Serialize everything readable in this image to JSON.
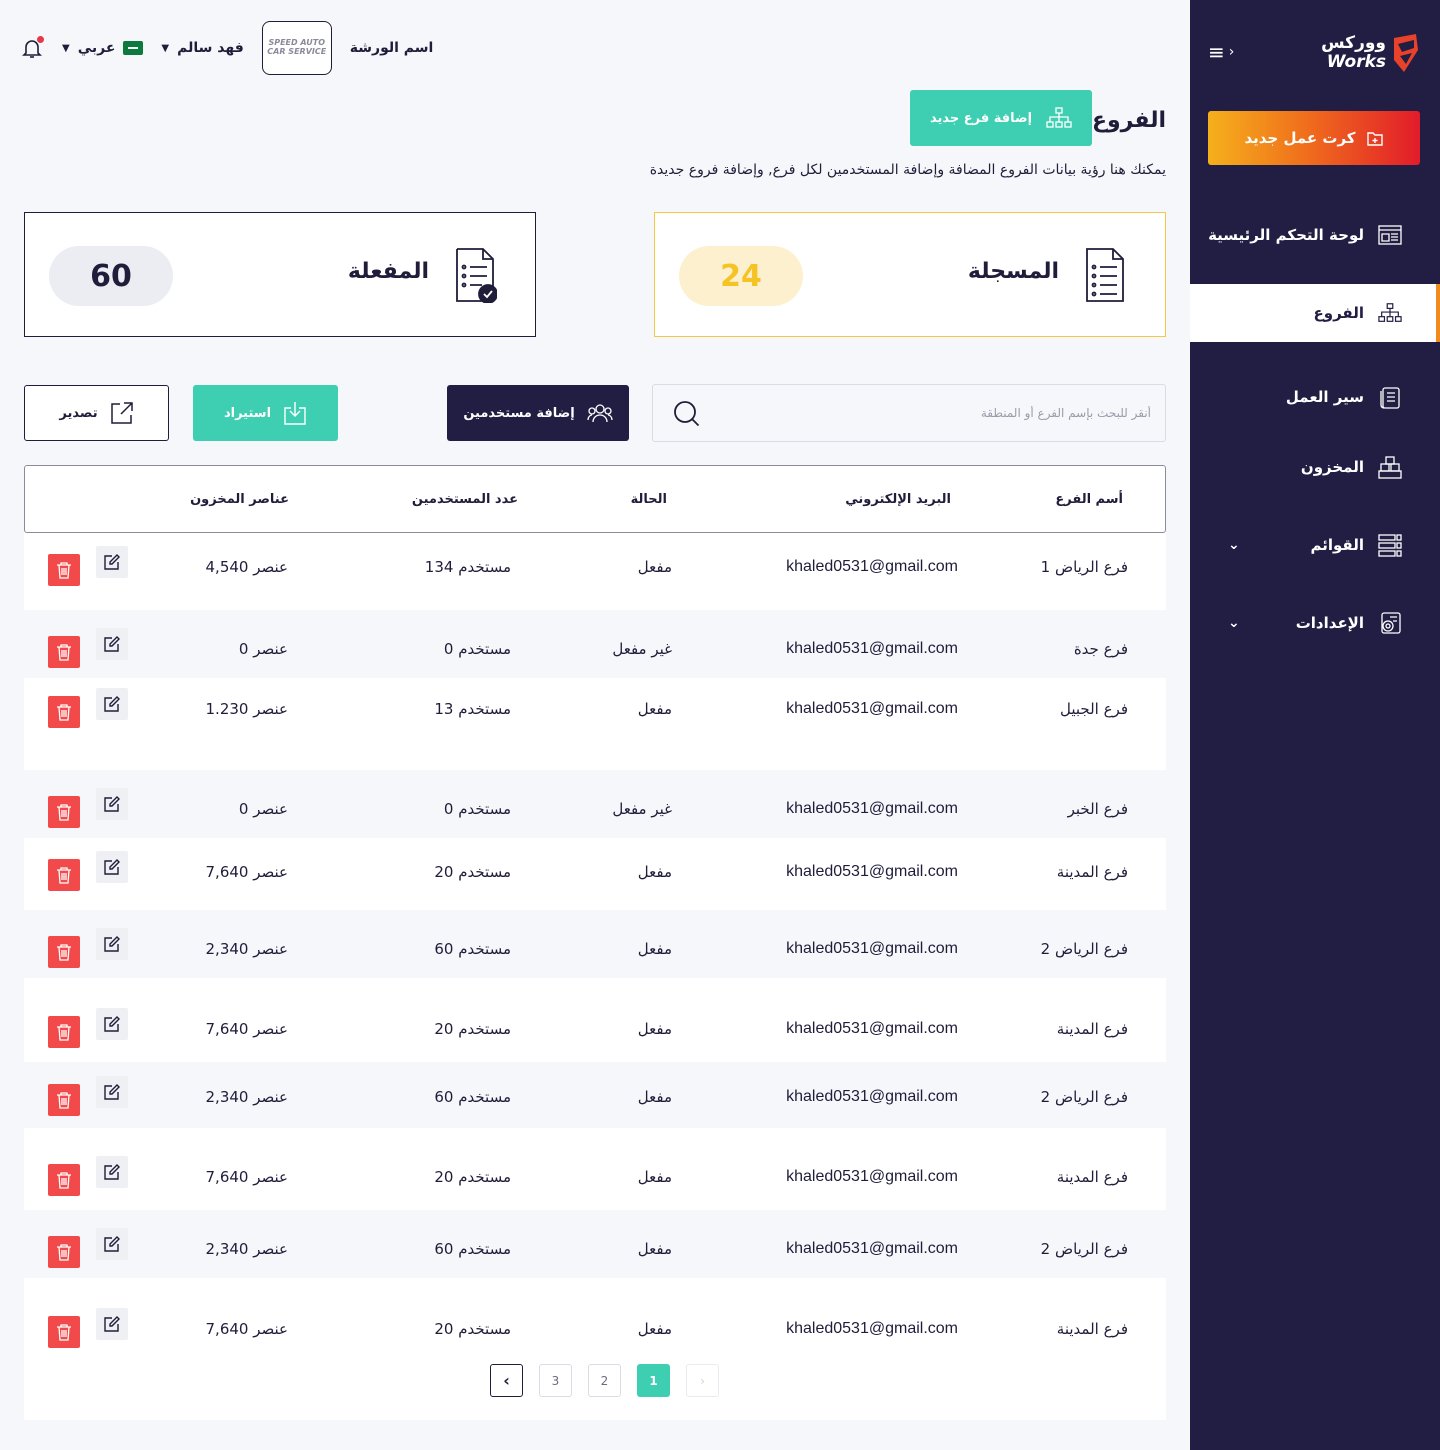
{
  "sidebar": {
    "brand_ar": "ووركس",
    "brand_en": "Works",
    "new_card_label": "كرت عمل جديد",
    "items": [
      {
        "label": "لوحة التحكم الرئيسية",
        "icon": "dashboard-icon"
      },
      {
        "label": "الفروع",
        "icon": "branches-icon",
        "active": true
      },
      {
        "label": "سير العمل",
        "icon": "workflow-icon"
      },
      {
        "label": "المخزون",
        "icon": "inventory-icon"
      },
      {
        "label": "القوائم",
        "icon": "lists-icon",
        "expandable": true
      },
      {
        "label": "الإعدادات",
        "icon": "settings-icon",
        "expandable": true
      }
    ]
  },
  "topbar": {
    "workshop_label": "اسم الورشة",
    "logo_text": "SPEED AUTO CAR SERVICE",
    "user_name": "فهد سالم",
    "language": "عربي"
  },
  "page": {
    "title": "الفروع",
    "add_branch_label": "إضافة فرع جديد",
    "description": "يمكنك هنا رؤية بيانات الفروع المضافة وإضافة المستخدمين لكل فرع, وإضافة فروع جديدة"
  },
  "stats": {
    "registered": {
      "label": "المسجلة",
      "value": "24"
    },
    "active": {
      "label": "المفعلة",
      "value": "60"
    }
  },
  "toolbar": {
    "search_placeholder": "أنقر للبحث بإسم الفرع أو المنطقة",
    "add_users_label": "إضافة مستخدمين",
    "import_label": "استيراد",
    "export_label": "تصدير"
  },
  "table": {
    "headers": {
      "name": "أسم الفرع",
      "email": "البريد الإلكتروني",
      "status": "الحالة",
      "users": "عدد المستخدمين",
      "stock": "عناصر المخزون"
    },
    "rows": [
      {
        "name": "فرع الرياض 1",
        "email": "khaled0531@gmail.com",
        "status": "مفعل",
        "users": "134 مستخدم",
        "stock": "4,540 عنصر"
      },
      {
        "name": "فرع جدة",
        "email": "khaled0531@gmail.com",
        "status": "غير مفعل",
        "users": "0 مستخدم",
        "stock": "0 عنصر"
      },
      {
        "name": "فرع الجبيل",
        "email": "khaled0531@gmail.com",
        "status": "مفعل",
        "users": "13 مستخدم",
        "stock": "1.230 عنصر"
      },
      {
        "name": "فرع الخبر",
        "email": "khaled0531@gmail.com",
        "status": "غير مفعل",
        "users": "0 مستخدم",
        "stock": "0 عنصر"
      },
      {
        "name": "فرع المدينة",
        "email": "khaled0531@gmail.com",
        "status": "مفعل",
        "users": "20 مستخدم",
        "stock": "7,640 عنصر"
      },
      {
        "name": "فرع الرياض 2",
        "email": "khaled0531@gmail.com",
        "status": "مفعل",
        "users": "60 مستخدم",
        "stock": "2,340 عنصر"
      },
      {
        "name": "فرع المدينة",
        "email": "khaled0531@gmail.com",
        "status": "مفعل",
        "users": "20 مستخدم",
        "stock": "7,640 عنصر"
      },
      {
        "name": "فرع الرياض 2",
        "email": "khaled0531@gmail.com",
        "status": "مفعل",
        "users": "60 مستخدم",
        "stock": "2,340 عنصر"
      },
      {
        "name": "فرع المدينة",
        "email": "khaled0531@gmail.com",
        "status": "مفعل",
        "users": "20 مستخدم",
        "stock": "7,640 عنصر"
      },
      {
        "name": "فرع الرياض 2",
        "email": "khaled0531@gmail.com",
        "status": "مفعل",
        "users": "60 مستخدم",
        "stock": "2,340 عنصر"
      },
      {
        "name": "فرع المدينة",
        "email": "khaled0531@gmail.com",
        "status": "مفعل",
        "users": "20 مستخدم",
        "stock": "7,640 عنصر"
      }
    ]
  },
  "pagination": {
    "pages": [
      "3",
      "2",
      "1"
    ],
    "current": "1"
  },
  "colors": {
    "sidebar_bg": "#221d43",
    "accent_teal": "#3ecfb3",
    "accent_yellow": "#f5c323",
    "danger": "#f24a4a",
    "brand_orange": "#f08c1c"
  }
}
